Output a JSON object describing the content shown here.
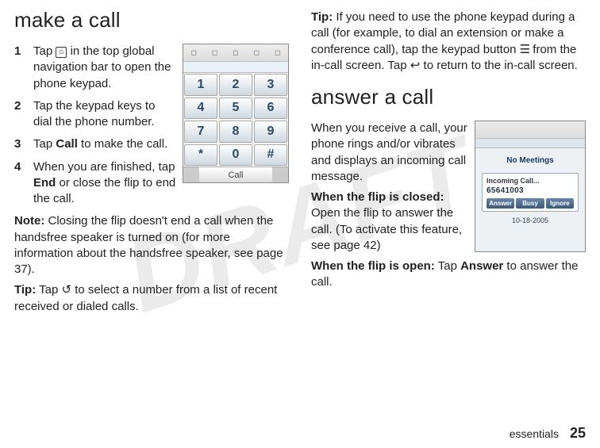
{
  "left": {
    "heading": "make a call",
    "steps": [
      {
        "num": "1",
        "pre": "Tap ",
        "post": " in the top global navigation bar to open the phone keypad."
      },
      {
        "num": "2",
        "text": "Tap the keypad keys to dial the phone number."
      },
      {
        "num": "3",
        "pre": "Tap ",
        "label": "Call",
        "post": " to make the call."
      },
      {
        "num": "4",
        "pre": "When you are finished, tap ",
        "label": "End",
        "post": " or close the flip to end the call."
      }
    ],
    "note": {
      "label": "Note:",
      "text": " Closing the flip doesn't end a call when the handsfree speaker is turned on (for more information about the handsfree speaker, see page 37)."
    },
    "tip": {
      "label": "Tip:",
      "pre": " Tap ",
      "post": " to select a number from a list of recent received or dialed calls."
    },
    "keypad": {
      "keys": [
        "1",
        "2",
        "3",
        "4",
        "5",
        "6",
        "7",
        "8",
        "9",
        "*",
        "0",
        "#"
      ],
      "call_label": "Call"
    }
  },
  "right": {
    "tip1": {
      "label": "Tip:",
      "pre": " If you need to use the phone keypad during a call (for example, to dial an extension or make a conference call), tap the keypad button ",
      "mid": " from the in-call screen. Tap ",
      "post": " to return to the in-call screen."
    },
    "heading": "answer a call",
    "intro": "When you receive a call, your phone rings and/or vibrates and displays an incoming call message.",
    "flip_closed": {
      "label": "When the flip is closed:",
      "text": " Open the flip to answer the call. (To activate this feature, see page 42)"
    },
    "flip_open": {
      "label": "When the flip is open:",
      "pre": " Tap ",
      "btn": "Answer",
      "post": " to answer the call."
    },
    "incoming": {
      "no_meetings": "No Meetings",
      "title": "Incoming Call...",
      "number": "65641003",
      "buttons": [
        "Answer",
        "Busy",
        "Ignore"
      ],
      "date": "10-18-2005"
    }
  },
  "footer": {
    "section": "essentials",
    "page": "25"
  }
}
